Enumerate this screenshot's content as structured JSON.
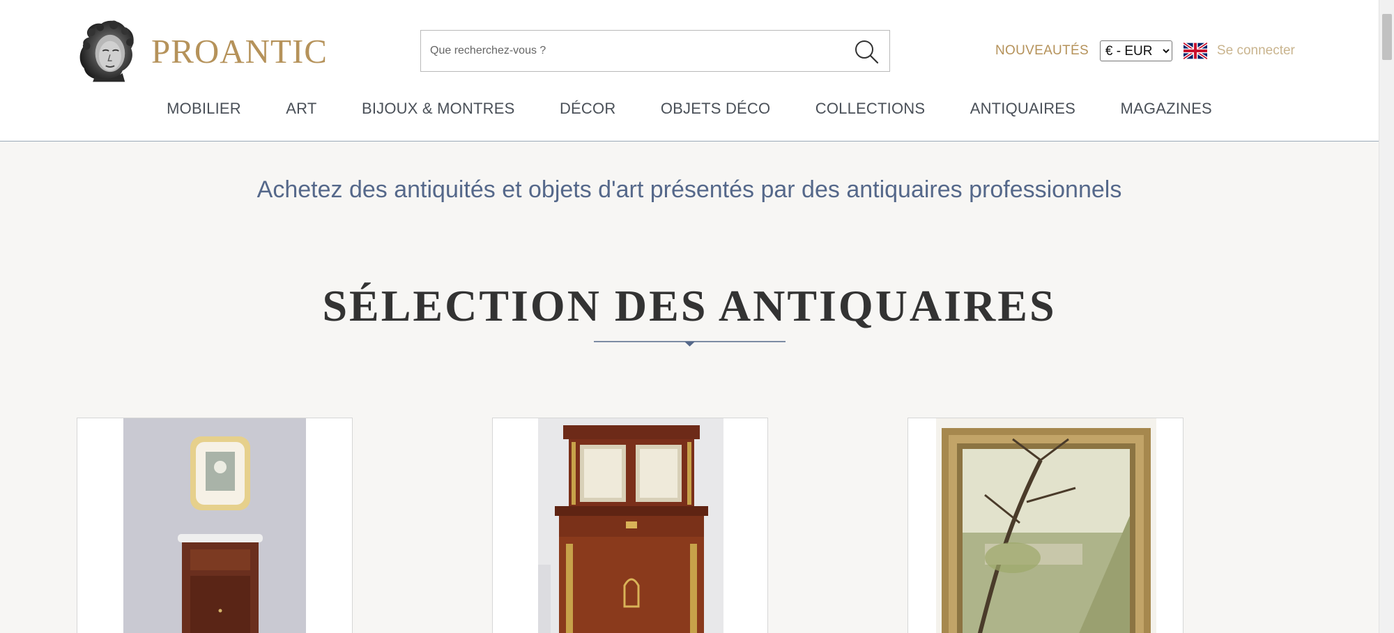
{
  "header": {
    "logo_text": "PROANTIC",
    "search_placeholder": "Que recherchez-vous ?",
    "news_label": "NOUVEAUTÉS",
    "currency_selected": "€ - EUR",
    "language_flag": "uk-flag-icon",
    "login_label": "Se connecter",
    "brand_color": "#b5925a"
  },
  "nav": {
    "items": [
      {
        "label": "MOBILIER"
      },
      {
        "label": "ART"
      },
      {
        "label": "BIJOUX & MONTRES"
      },
      {
        "label": "DÉCOR"
      },
      {
        "label": "OBJETS DÉCO"
      },
      {
        "label": "COLLECTIONS"
      },
      {
        "label": "ANTIQUAIRES"
      },
      {
        "label": "MAGAZINES"
      }
    ]
  },
  "main": {
    "tagline": "Achetez des antiquités et objets d'art présentés par des antiquaires professionnels",
    "section_title": "SÉLECTION DES ANTIQUAIRES",
    "products": [
      {
        "image": "mirror-and-cabinet"
      },
      {
        "image": "mahogany-secretary"
      },
      {
        "image": "framed-landscape-painting"
      }
    ]
  }
}
